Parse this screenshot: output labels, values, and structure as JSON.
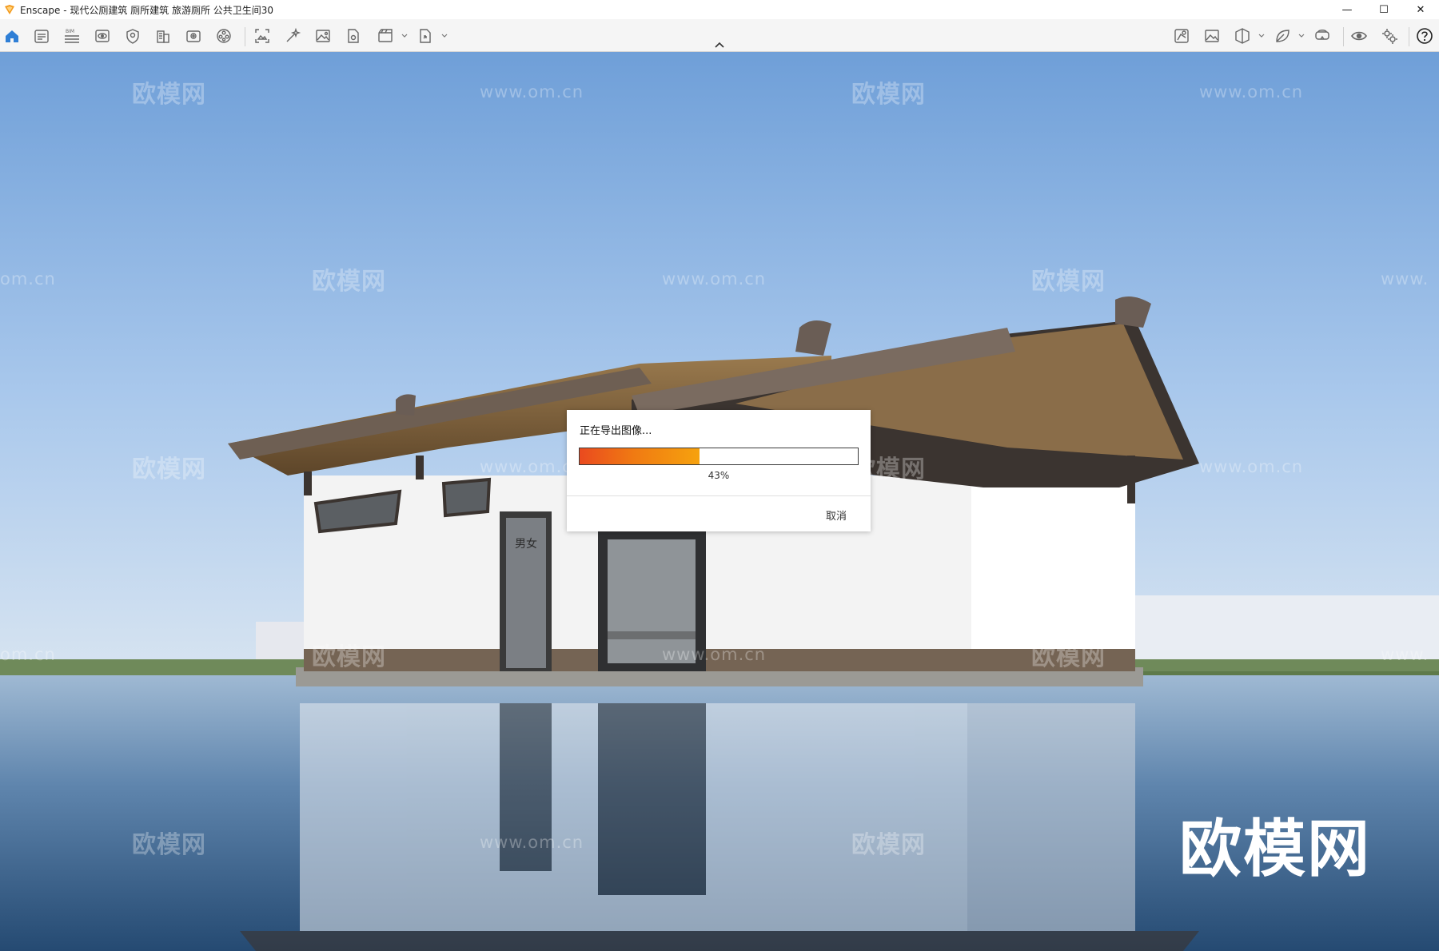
{
  "window": {
    "app_name": "Enscape",
    "title": "Enscape - 现代公厕建筑 厕所建筑 旅游厕所 公共卫生间30",
    "controls": [
      {
        "name": "minimize-button",
        "glyph": "—"
      },
      {
        "name": "maximize-button",
        "glyph": "☐"
      },
      {
        "name": "close-button",
        "glyph": "✕"
      }
    ]
  },
  "toolbar": {
    "accent_color": "#2f7fd6",
    "left_icons": [
      "home-icon",
      "document-icon",
      "bim-icon",
      "view-icon",
      "shield-icon",
      "building-icon",
      "asset-library-icon",
      "material-editor-icon",
      "screenshot-icon",
      "magic-wand-icon",
      "image-icon",
      "settings-document-icon",
      "video-editor-icon",
      "export-icon"
    ],
    "bim_label": "BIM",
    "right_icons": [
      "map-icon",
      "gallery-icon",
      "cube-view-icon",
      "leaf-icon",
      "vr-headset-icon",
      "visibility-eye-icon",
      "settings-gear-icon",
      "help-icon"
    ]
  },
  "viewport": {
    "watermark_text": "欧模网",
    "watermark_url": "www.om.cn",
    "watermark_url_partial": "om.cn",
    "watermark_url_cut": "www.",
    "brand_logo": "欧模网",
    "door_sign": "男女"
  },
  "export_dialog": {
    "title": "正在导出图像...",
    "progress_percent": 43,
    "progress_label": "43%",
    "cancel_label": "取消",
    "progress_colors": [
      "#ea4a1f",
      "#f6a20e"
    ]
  }
}
